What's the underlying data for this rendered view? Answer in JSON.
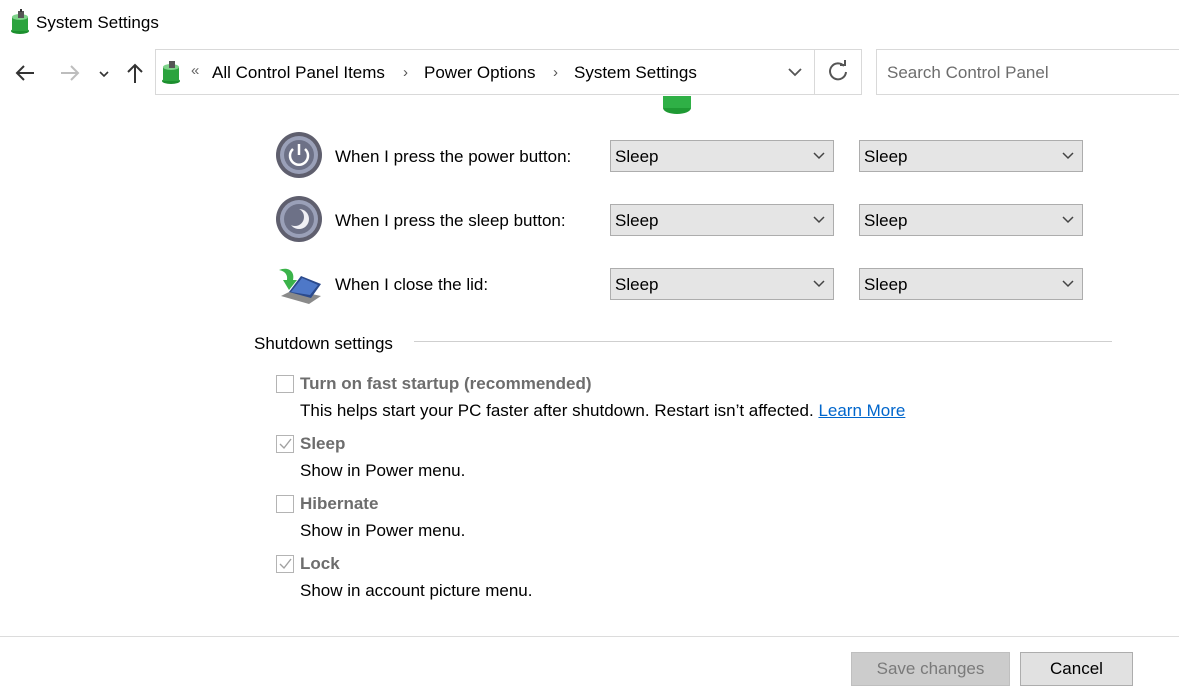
{
  "window": {
    "title": "System Settings"
  },
  "nav": {
    "back_icon": "arrow-left-icon",
    "forward_icon": "arrow-right-icon",
    "recent_icon": "chevron-down-icon",
    "up_icon": "arrow-up-icon"
  },
  "address": {
    "overflow": "«",
    "crumbs": [
      "All Control Panel Items",
      "Power Options",
      "System Settings"
    ],
    "separator": "›"
  },
  "search": {
    "placeholder": "Search Control Panel"
  },
  "rows": [
    {
      "label": "When I press the power button:",
      "icon": "power-button-icon",
      "on_battery": "Sleep",
      "plugged_in": "Sleep"
    },
    {
      "label": "When I press the sleep button:",
      "icon": "sleep-button-icon",
      "on_battery": "Sleep",
      "plugged_in": "Sleep"
    },
    {
      "label": "When I close the lid:",
      "icon": "laptop-lid-icon",
      "on_battery": "Sleep",
      "plugged_in": "Sleep"
    }
  ],
  "shutdown": {
    "title": "Shutdown settings",
    "options": [
      {
        "title": "Turn on fast startup (recommended)",
        "desc": "This helps start your PC faster after shutdown. Restart isn’t affected.",
        "link": "Learn More",
        "checked": false
      },
      {
        "title": "Sleep",
        "desc": "Show in Power menu.",
        "checked": true
      },
      {
        "title": "Hibernate",
        "desc": "Show in Power menu.",
        "checked": false
      },
      {
        "title": "Lock",
        "desc": "Show in account picture menu.",
        "checked": true
      }
    ]
  },
  "buttons": {
    "save": "Save changes",
    "cancel": "Cancel"
  },
  "colors": {
    "link": "#0066cc",
    "disabled_text": "#6d6d6d",
    "dropdown_bg": "#e5e5e5"
  }
}
